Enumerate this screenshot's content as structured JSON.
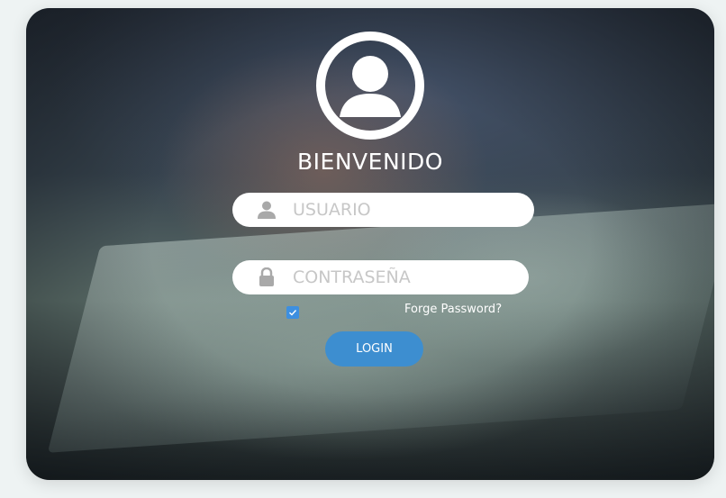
{
  "login": {
    "title": "BIENVENIDO",
    "username_placeholder": "USUARIO",
    "password_placeholder": "CONTRASEÑA",
    "remember_checked": true,
    "forgot_label": "Forge Password?",
    "login_label": "LOGIN"
  },
  "icons": {
    "avatar": "user-circle-icon",
    "username": "user-icon",
    "password": "lock-icon",
    "checkbox": "check-icon"
  },
  "colors": {
    "accent": "#3d8ed0",
    "checkbox": "#3d8fe0",
    "field_background": "#ffffff",
    "text_light": "#ffffff",
    "page_background": "#eef3f3"
  }
}
